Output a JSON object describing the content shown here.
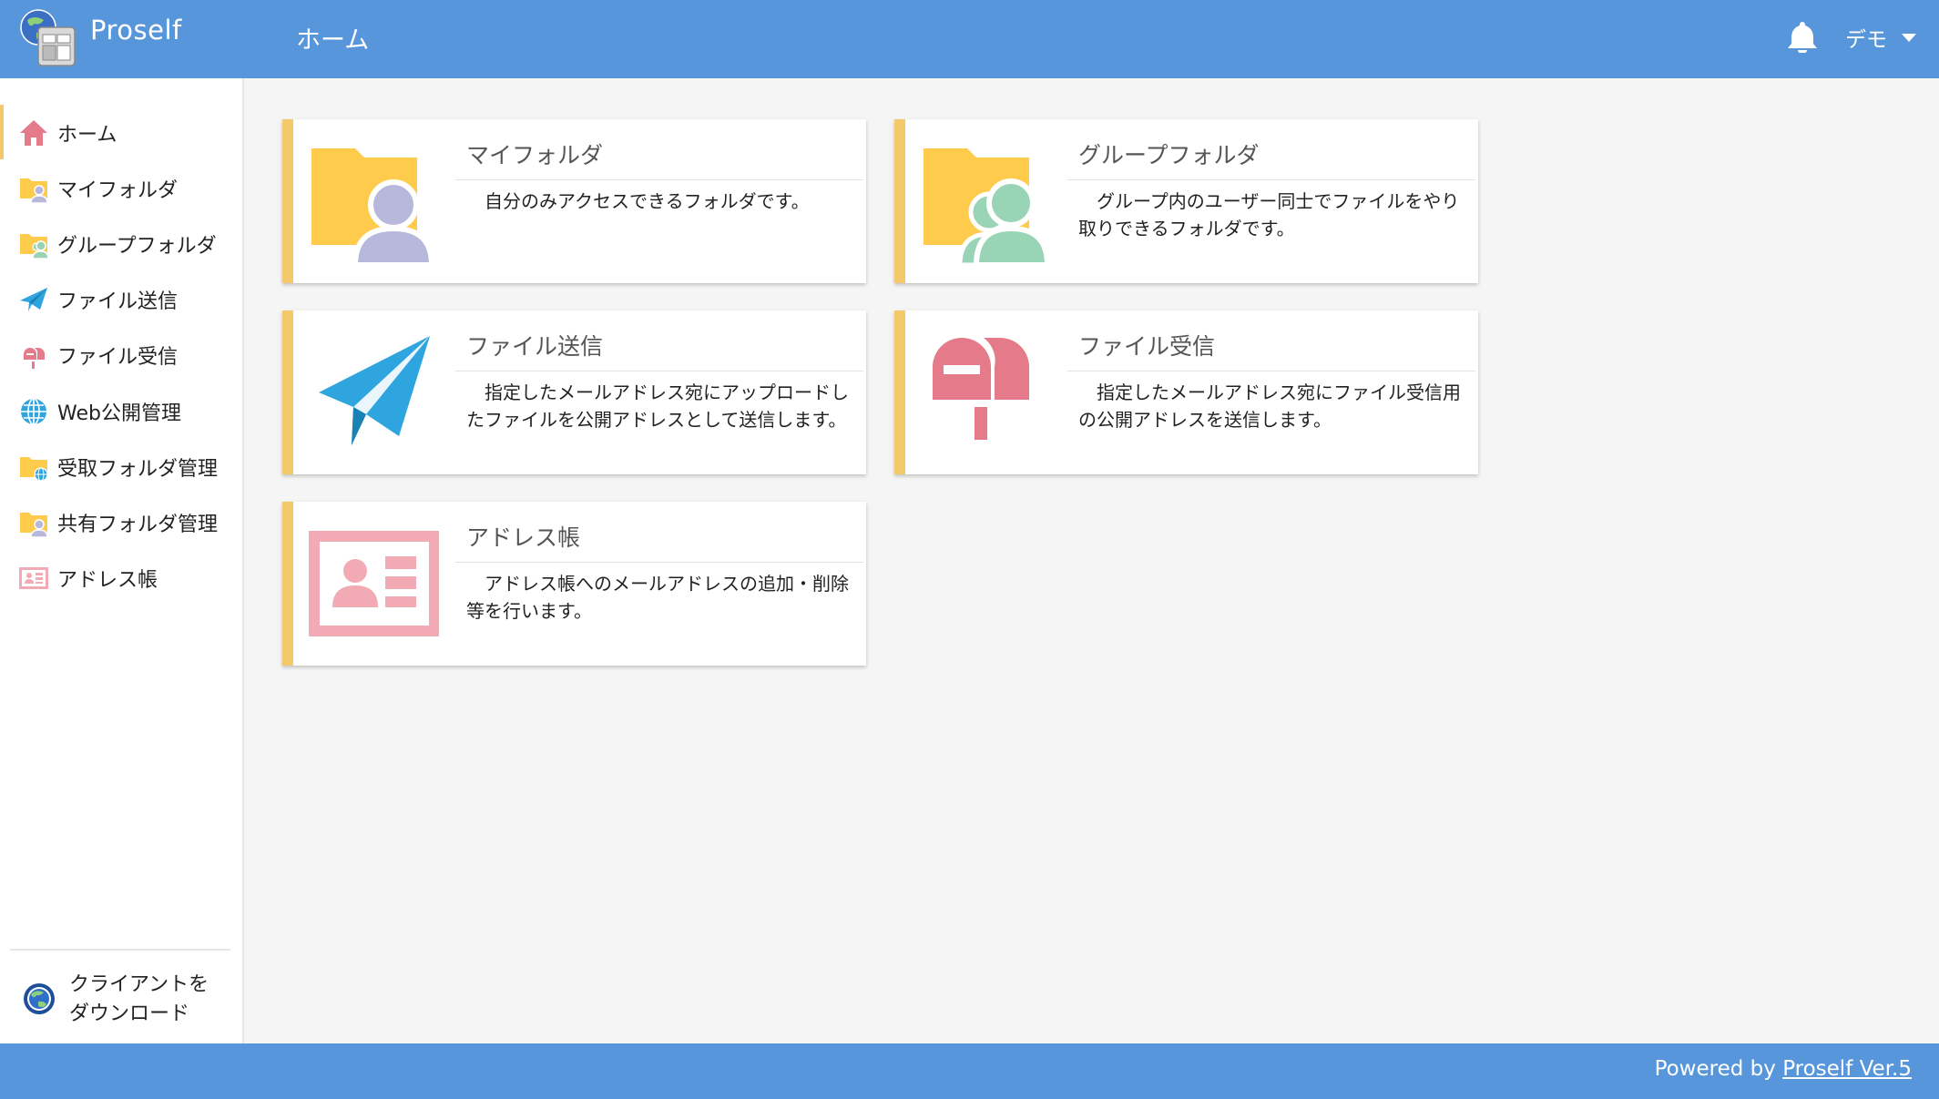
{
  "app": {
    "name": "Proself"
  },
  "header": {
    "title": "ホーム",
    "user": "デモ"
  },
  "sidebar": {
    "items": [
      {
        "label": "ホーム",
        "icon": "home-icon",
        "active": true
      },
      {
        "label": "マイフォルダ",
        "icon": "my-folder-icon"
      },
      {
        "label": "グループフォルダ",
        "icon": "group-folder-icon"
      },
      {
        "label": "ファイル送信",
        "icon": "paper-plane-icon"
      },
      {
        "label": "ファイル受信",
        "icon": "mailbox-icon"
      },
      {
        "label": "Web公開管理",
        "icon": "globe-icon"
      },
      {
        "label": "受取フォルダ管理",
        "icon": "receive-folder-icon"
      },
      {
        "label": "共有フォルダ管理",
        "icon": "shared-folder-icon"
      },
      {
        "label": "アドレス帳",
        "icon": "address-book-icon"
      }
    ],
    "download": {
      "line1": "クライアントを",
      "line2": "ダウンロード"
    }
  },
  "cards": [
    {
      "title": "マイフォルダ",
      "desc": "自分のみアクセスできるフォルダです。"
    },
    {
      "title": "グループフォルダ",
      "desc": "グループ内のユーザー同士でファイルをやり取りできるフォルダです。"
    },
    {
      "title": "ファイル送信",
      "desc": "指定したメールアドレス宛にアップロードしたファイルを公開アドレスとして送信します。"
    },
    {
      "title": "ファイル受信",
      "desc": "指定したメールアドレス宛にファイル受信用の公開アドレスを送信します。"
    },
    {
      "title": "アドレス帳",
      "desc": "アドレス帳へのメールアドレスの追加・削除等を行います。"
    }
  ],
  "footer": {
    "prefix": "Powered by ",
    "link": "Proself Ver.5"
  },
  "colors": {
    "header": "#5896dc",
    "accent": "#f3c96b",
    "folder": "#fecb4d",
    "user_purple": "#b7b8dc",
    "user_green": "#99d4b6",
    "plane_blue": "#2ea5de",
    "mailbox_red": "#e57b8a",
    "address_pink": "#f2aab5"
  }
}
